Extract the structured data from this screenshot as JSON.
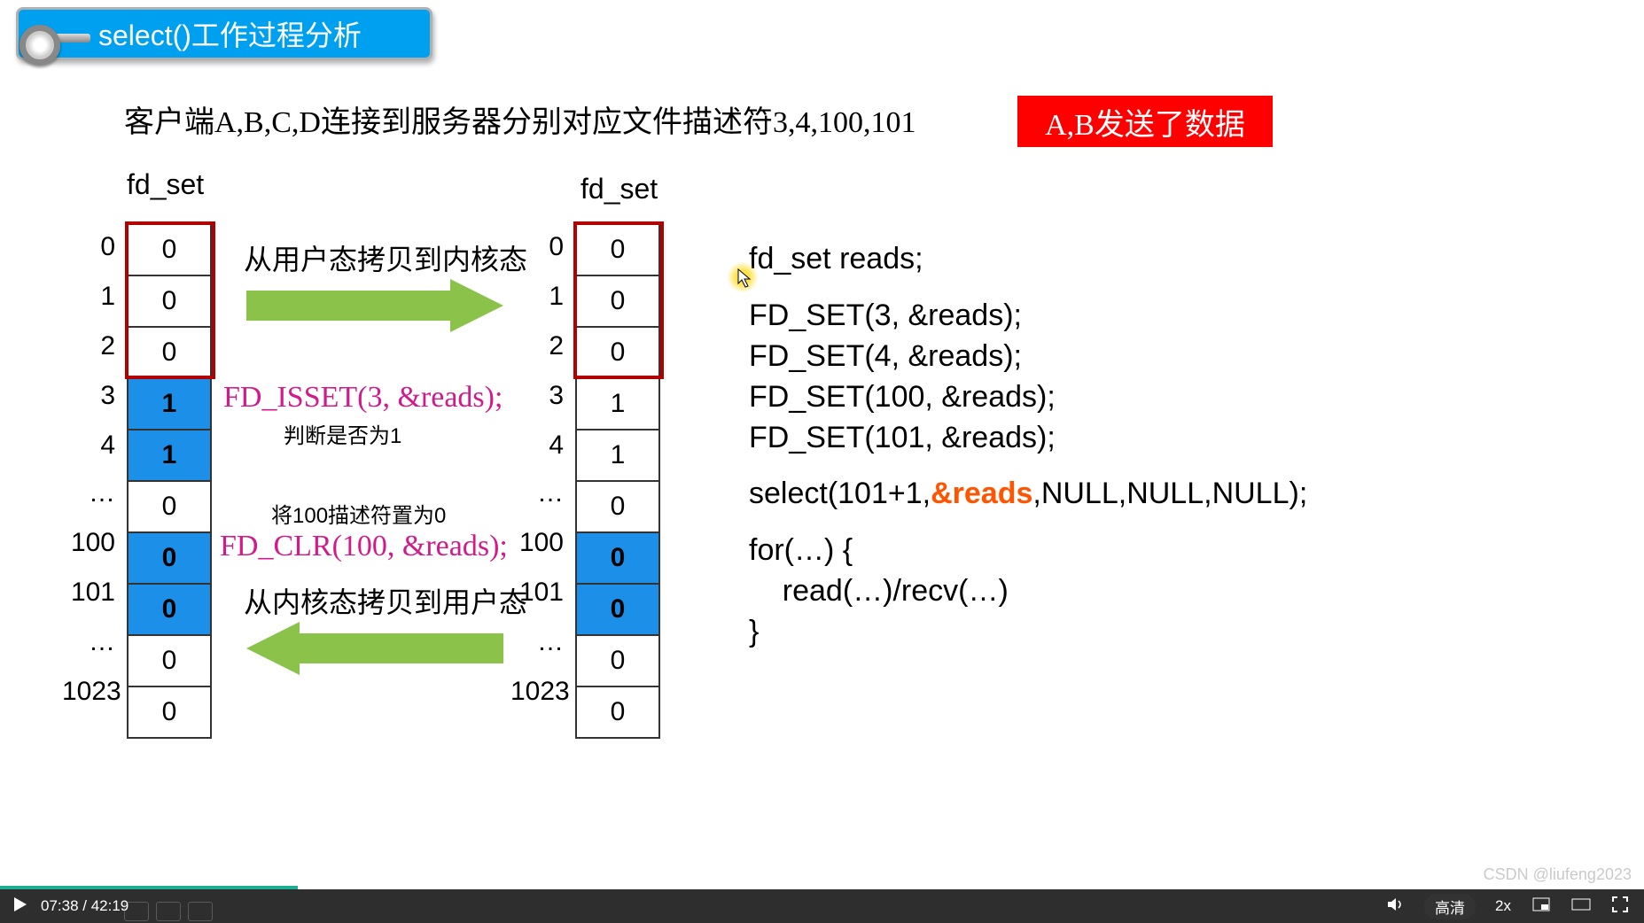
{
  "title": "select()工作过程分析",
  "subtitle": "客户端A,B,C,D连接到服务器分别对应文件描述符3,4,100,101",
  "badge": "A,B发送了数据",
  "fdset_label": "fd_set",
  "row_labels": [
    "0",
    "1",
    "2",
    "3",
    "4",
    "…",
    "100",
    "101",
    "…",
    "1023"
  ],
  "left_table": [
    "0",
    "0",
    "0",
    "1",
    "1",
    "0",
    "0",
    "0",
    "0",
    "0"
  ],
  "right_table": [
    "0",
    "0",
    "0",
    "1",
    "1",
    "0",
    "0",
    "0",
    "0",
    "0"
  ],
  "left_hl": [
    false,
    false,
    false,
    true,
    true,
    false,
    true,
    true,
    false,
    false
  ],
  "right_hl": [
    false,
    false,
    false,
    false,
    false,
    false,
    true,
    true,
    false,
    false
  ],
  "arrow_top": "从用户态拷贝到内核态",
  "arrow_bot": "从内核态拷贝到用户态",
  "isset_line": "FD_ISSET(3, &reads);",
  "isset_note": "判断是否为1",
  "clr_line": "FD_CLR(100, &reads);",
  "clr_note": "将100描述符置为0",
  "code": {
    "l1": "fd_set reads;",
    "l2": "FD_SET(3, &reads);",
    "l3": "FD_SET(4, &reads);",
    "l4": "FD_SET(100, &reads);",
    "l5": "FD_SET(101, &reads);",
    "l6a": "select(101+1,",
    "l6b": "&reads",
    "l6c": ",NULL,NULL,NULL);",
    "l7": "for(…) {",
    "l8": "    read(…)/recv(…)",
    "l9": "}"
  },
  "player": {
    "time": "07:38 / 42:19",
    "quality": "高清",
    "speed": "2x",
    "watermark": "CSDN @liufeng2023"
  },
  "progress_pct": 18.1
}
